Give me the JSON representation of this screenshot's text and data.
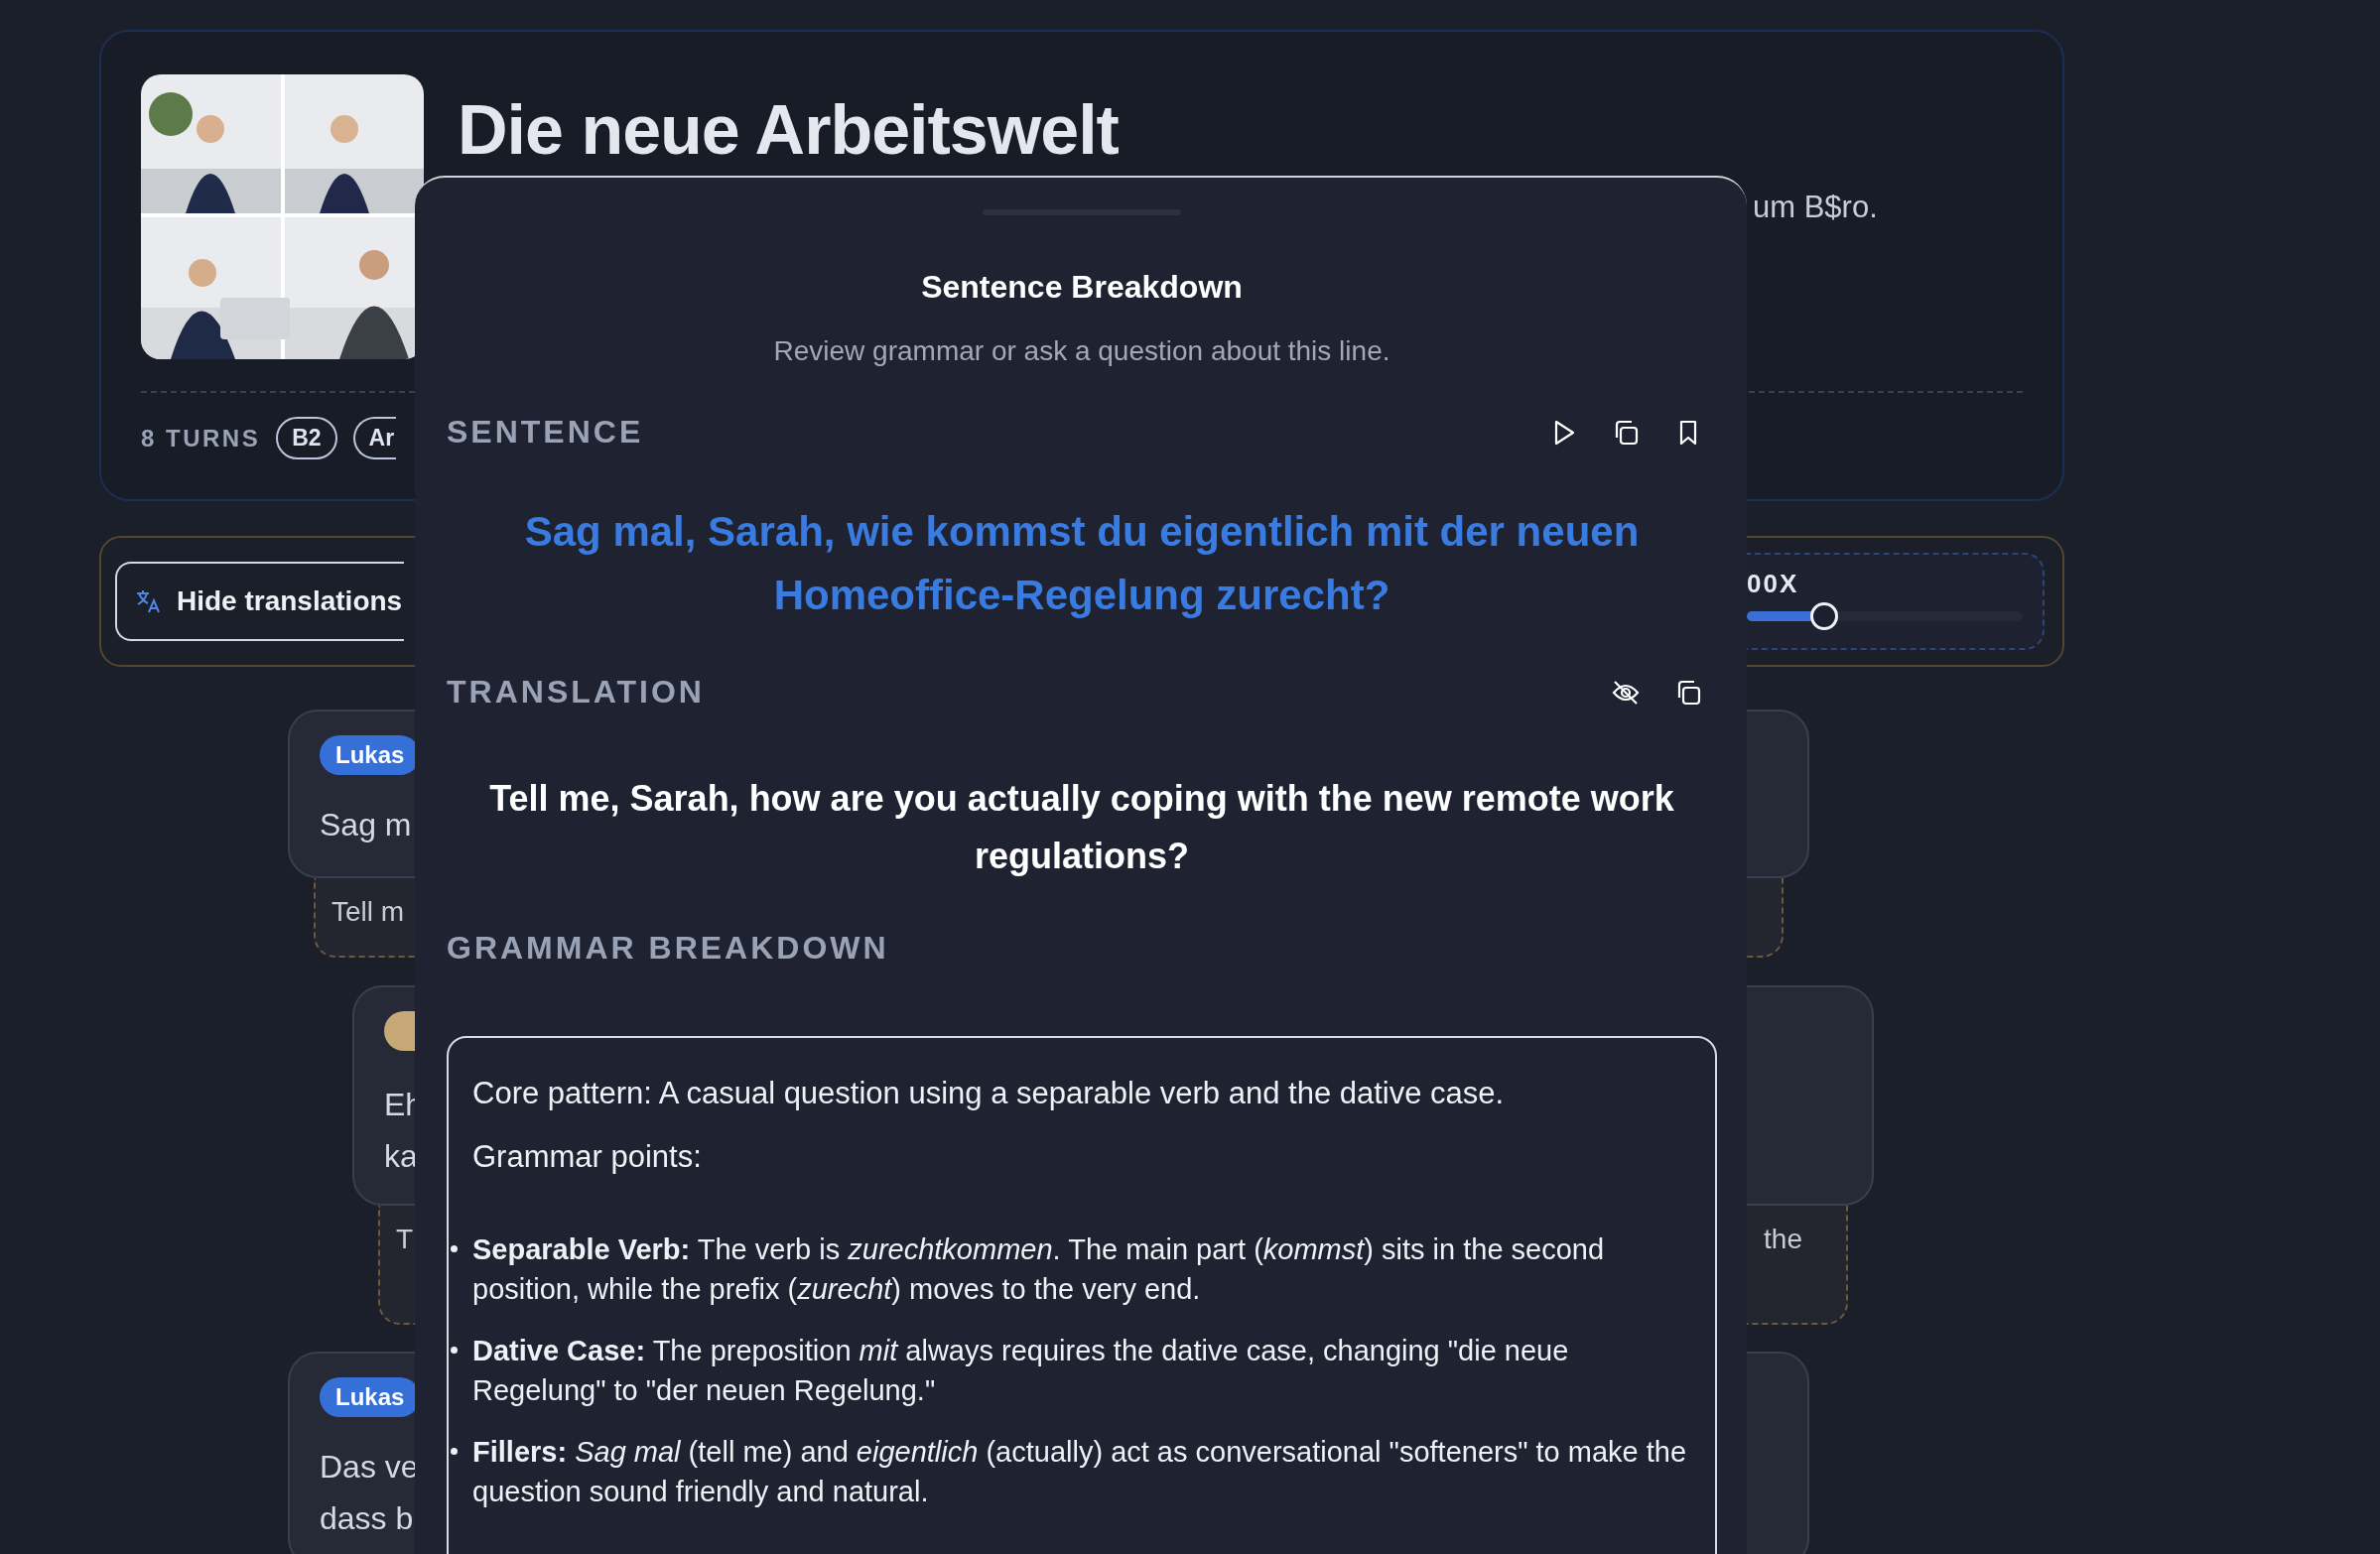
{
  "header": {
    "title": "Die neue Arbeitswelt",
    "subtitle_end": "um B$ro.",
    "turns": "8 TURNS",
    "tags": [
      "B2",
      "Ar"
    ]
  },
  "controls": {
    "translation_toggle": "Hide translations",
    "speed": {
      "label_end": "00X",
      "level": 0.28
    }
  },
  "dialogue": [
    {
      "speaker": "Lukas",
      "color": "#3570d8",
      "lines": [
        "Sag m"
      ],
      "translation_start": "Tell m"
    },
    {
      "color": "#c7a978",
      "lines": [
        "Eh",
        "ka"
      ],
      "translation_start": "T",
      "translation_end": "the"
    },
    {
      "speaker": "Lukas",
      "color": "#3570d8",
      "lines": [
        "Das ve",
        "dass b"
      ]
    }
  ],
  "sheet": {
    "title": "Sentence Breakdown",
    "subtitle": "Review grammar or ask a question about this line.",
    "sentence_label": "SENTENCE",
    "sentence": "Sag mal, Sarah, wie kommst du eigentlich mit der neuen Homeoffice-Regelung zurecht?",
    "translation_label": "TRANSLATION",
    "translation": "Tell me, Sarah, how are you actually coping with the new remote work regulations?",
    "grammar_label": "GRAMMAR BREAKDOWN",
    "core": "Core pattern: A casual question using a separable verb and the dative case.",
    "points_heading": "Grammar points:",
    "points": [
      "**Separable Verb:** The verb is *zurechtkommen*. The main part (*kommst*) sits in the second position, while the prefix (*zurecht*) moves to the very end.",
      "**Dative Case:** The preposition *mit* always requires the dative case, changing \"die neue Regelung\" to \"der neuen Regelung.\"",
      "**Fillers:** *Sag mal* (tell me) and *eigentlich* (actually) act as conversational \"softeners\" to make the question sound friendly and natural."
    ]
  }
}
